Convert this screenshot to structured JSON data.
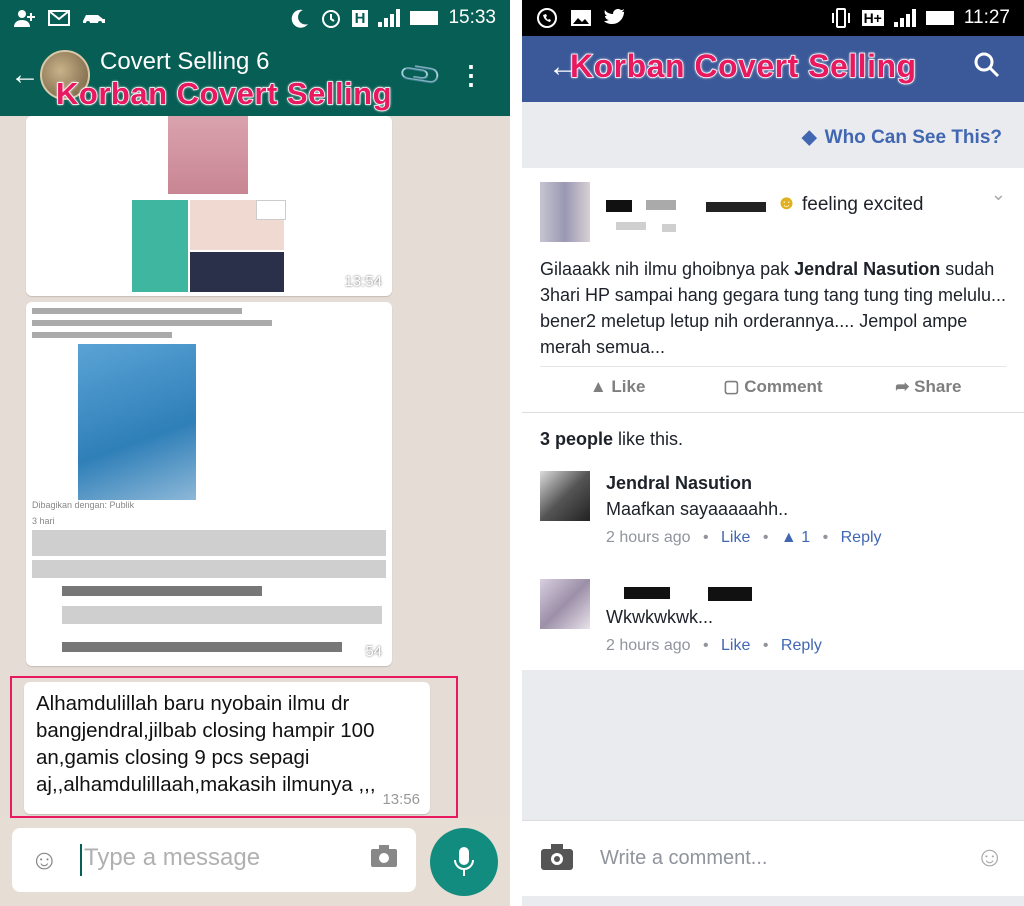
{
  "whatsapp": {
    "status_time": "15:33",
    "status_network": "H",
    "chat_title": "Covert Selling 6",
    "overlay_label": "Korban  Covert Selling",
    "messages": [
      {
        "time": "13:54"
      },
      {
        "caption": "Dibagikan dengan: Publik",
        "likes_text": "3 hari",
        "time": "54"
      },
      {
        "text": "Alhamdulillah baru nyobain ilmu dr bangjendral,jilbab closing  hampir 100 an,gamis closing 9 pcs sepagi aj,,alhamdulillaah,makasih ilmunya ,,,",
        "time": "13:56"
      }
    ],
    "input_placeholder": "Type a message",
    "icons": [
      "person-add-icon",
      "mail-icon",
      "car-icon",
      "moon-icon",
      "alarm-icon",
      "signal-icon",
      "battery-icon",
      "back-arrow-icon",
      "paperclip-icon",
      "more-vertical-icon",
      "emoji-icon",
      "camera-icon",
      "mic-icon"
    ],
    "colors": {
      "header": "#075e54",
      "accent": "#128c7e",
      "highlight": "#e8195f"
    }
  },
  "facebook": {
    "status_time": "11:27",
    "status_network": "H+",
    "overlay_label": "Korban Covert Selling",
    "who_can_see": "Who Can See This?",
    "post": {
      "feeling": "feeling excited",
      "body_prefix": "Gilaaakk nih ilmu ghoibnya pak ",
      "body_bold": "Jendral Nasution",
      "body_suffix": " sudah 3hari HP sampai hang gegara tung tang tung ting melulu... bener2 meletup letup nih orderannya.... Jempol ampe merah semua...",
      "actions": [
        "Like",
        "Comment",
        "Share"
      ]
    },
    "likes_count": "3 people",
    "likes_suffix": " like this.",
    "comments": [
      {
        "name": "Jendral Nasution",
        "text": "Maafkan sayaaaaahh..",
        "time": "2 hours ago",
        "like": "Like",
        "like_count": "1",
        "reply": "Reply"
      },
      {
        "name": "",
        "text": "Wkwkwkwk...",
        "time": "2 hours ago",
        "like": "Like",
        "reply": "Reply"
      }
    ],
    "comment_placeholder": "Write a comment...",
    "icons": [
      "whatsapp-icon",
      "image-icon",
      "twitter-icon",
      "vibrate-icon",
      "signal-icon",
      "battery-icon",
      "back-arrow-icon",
      "search-icon",
      "tag-icon",
      "emoji-icon",
      "chevron-down-icon",
      "thumbs-up-icon",
      "comment-icon",
      "share-icon",
      "camera-icon",
      "smile-icon"
    ],
    "colors": {
      "header": "#3b5998",
      "link": "#4267b2"
    }
  },
  "separators": {
    "bullet": "•"
  }
}
